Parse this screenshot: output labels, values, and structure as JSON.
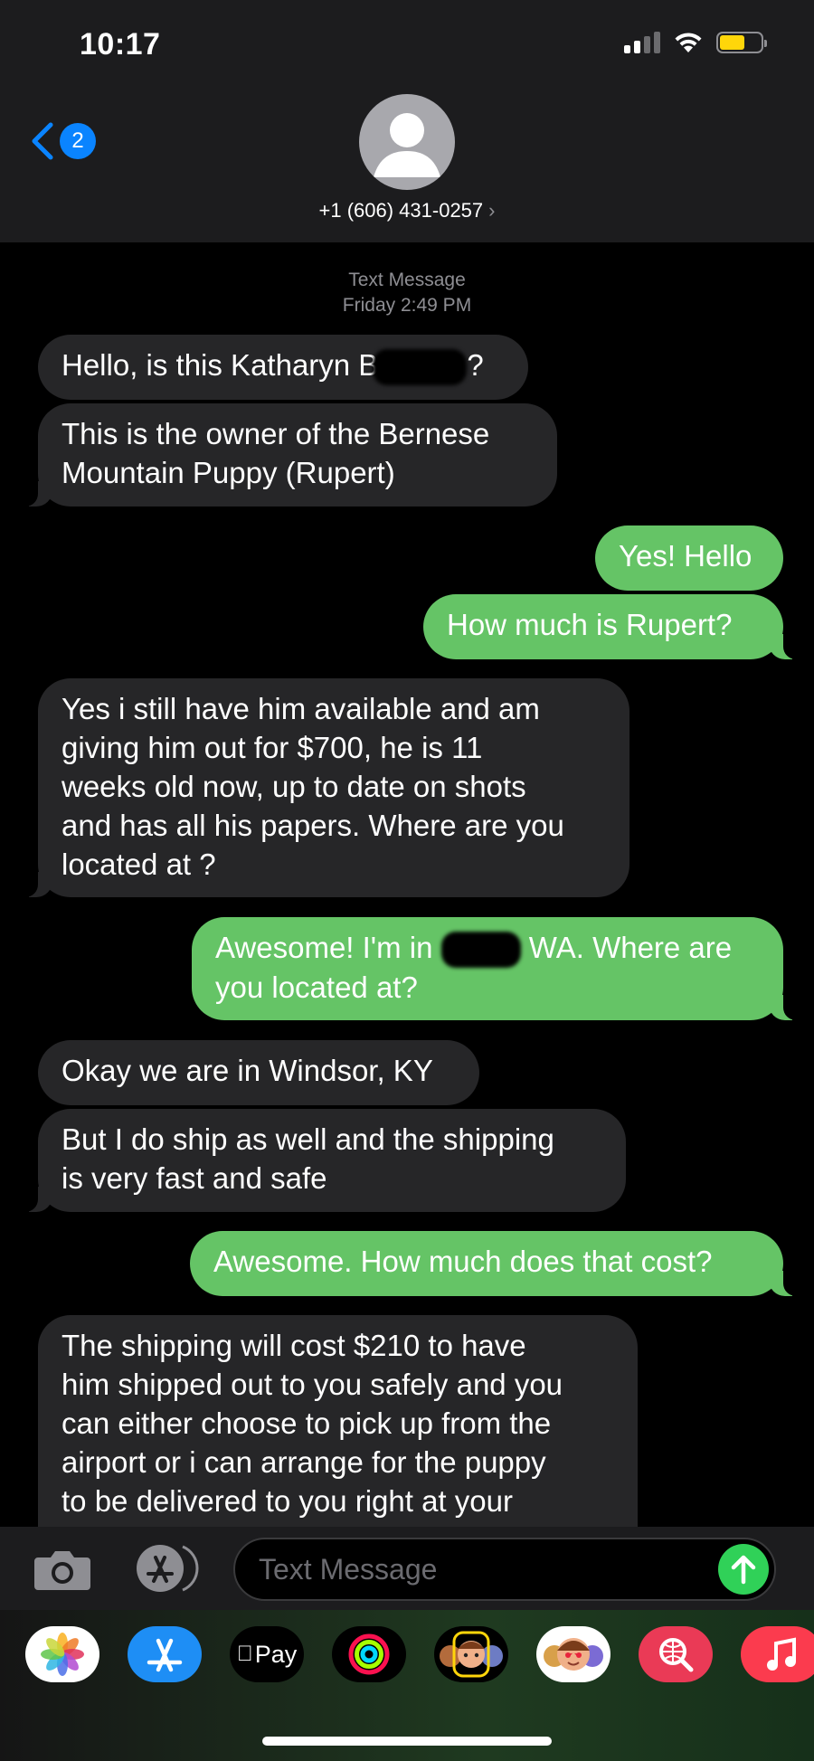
{
  "status_bar": {
    "time": "10:17"
  },
  "header": {
    "back_badge": "2",
    "contact_name": "+1 (606) 431-0257",
    "contact_chevron": "›"
  },
  "conversation": {
    "timestamp_type": "Text Message",
    "timestamp_time": "Friday 2:49 PM",
    "messages": [
      {
        "from": "them",
        "text": "Hello, is this Katharyn B",
        "text_after": "?"
      },
      {
        "from": "them",
        "lines": [
          "This is the owner of the Bernese",
          "Mountain Puppy (Rupert)"
        ]
      },
      {
        "from": "me",
        "text": "Yes! Hello"
      },
      {
        "from": "me",
        "text": "How much is Rupert?"
      },
      {
        "from": "them",
        "lines": [
          "Yes i still have him available and am",
          "giving him out for $700, he is 11",
          "weeks old now, up to date on shots",
          "and has all his papers. Where are you",
          "located at ?"
        ]
      },
      {
        "from": "me",
        "line1_before": "Awesome! I'm in",
        "line1_after": "WA. Where are",
        "line2": "you located at?"
      },
      {
        "from": "them",
        "text": "Okay we are in Windsor, KY"
      },
      {
        "from": "them",
        "lines": [
          "But I do ship as well and the shipping",
          "is very fast and safe"
        ]
      },
      {
        "from": "me",
        "text": "Awesome. How much does that cost?"
      },
      {
        "from": "them",
        "lines": [
          "The shipping will cost $210 to have",
          "him shipped out to you safely and you",
          "can either choose to pick up from the",
          "airport or i can arrange for the puppy",
          "to be delivered to you right at your"
        ]
      }
    ]
  },
  "input_bar": {
    "placeholder": "Text Message"
  },
  "app_drawer": {
    "apps": [
      {
        "name": "Photos",
        "icon": "photos-icon"
      },
      {
        "name": "App Store",
        "icon": "app-store-icon"
      },
      {
        "name": "Apple Pay",
        "icon": "apple-pay-icon",
        "label": "Pay"
      },
      {
        "name": "Activity",
        "icon": "activity-rings-icon"
      },
      {
        "name": "Memoji",
        "icon": "memoji-icon"
      },
      {
        "name": "Memoji Stickers",
        "icon": "memoji-stickers-icon"
      },
      {
        "name": "Images",
        "icon": "web-search-icon"
      },
      {
        "name": "Music",
        "icon": "music-icon"
      }
    ]
  },
  "colors": {
    "incoming_bubble": "#262628",
    "outgoing_bubble": "#65c466",
    "accent": "#0a84ff",
    "send": "#30d158"
  }
}
